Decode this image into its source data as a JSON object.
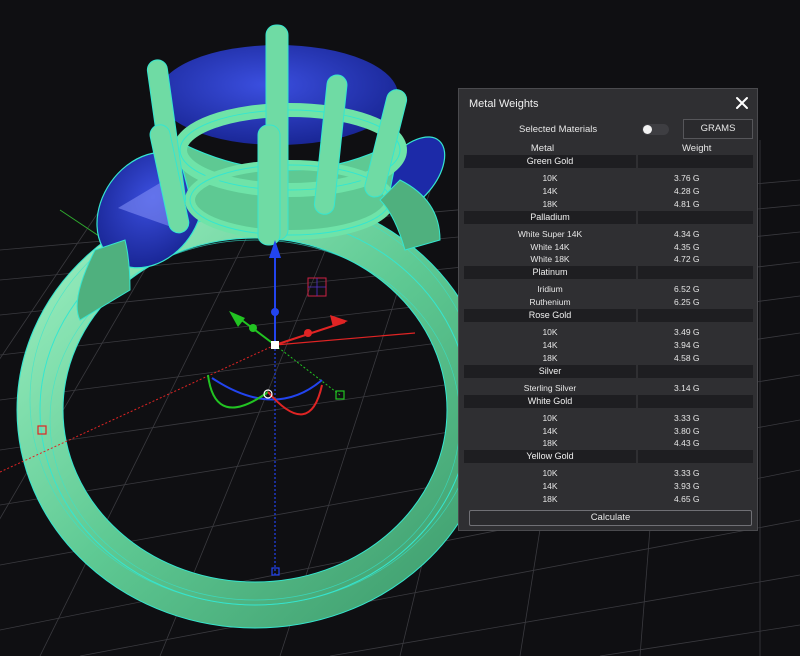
{
  "panel": {
    "title": "Metal Weights",
    "selected_materials_label": "Selected Materials",
    "units_button": "GRAMS",
    "calculate_button": "Calculate",
    "columns": {
      "metal": "Metal",
      "weight": "Weight"
    }
  },
  "groups": [
    {
      "name": "Green Gold",
      "rows": [
        {
          "metal": "10K",
          "weight": "3.76 G"
        },
        {
          "metal": "14K",
          "weight": "4.28 G"
        },
        {
          "metal": "18K",
          "weight": "4.81 G"
        }
      ]
    },
    {
      "name": "Palladium",
      "rows": [
        {
          "metal": "White Super 14K",
          "weight": "4.34 G"
        },
        {
          "metal": "White 14K",
          "weight": "4.35 G"
        },
        {
          "metal": "White 18K",
          "weight": "4.72 G"
        }
      ]
    },
    {
      "name": "Platinum",
      "rows": [
        {
          "metal": "Iridium",
          "weight": "6.52 G"
        },
        {
          "metal": "Ruthenium",
          "weight": "6.25 G"
        }
      ]
    },
    {
      "name": "Rose Gold",
      "rows": [
        {
          "metal": "10K",
          "weight": "3.49 G"
        },
        {
          "metal": "14K",
          "weight": "3.94 G"
        },
        {
          "metal": "18K",
          "weight": "4.58 G"
        }
      ]
    },
    {
      "name": "Silver",
      "rows": [
        {
          "metal": "Sterling Silver",
          "weight": "3.14 G"
        }
      ]
    },
    {
      "name": "White Gold",
      "rows": [
        {
          "metal": "10K",
          "weight": "3.33 G"
        },
        {
          "metal": "14K",
          "weight": "3.80 G"
        },
        {
          "metal": "18K",
          "weight": "4.43 G"
        }
      ]
    },
    {
      "name": "Yellow Gold",
      "rows": [
        {
          "metal": "10K",
          "weight": "3.33 G"
        },
        {
          "metal": "14K",
          "weight": "3.93 G"
        },
        {
          "metal": "18K",
          "weight": "4.65 G"
        }
      ]
    }
  ],
  "colors": {
    "metal_green": "#6fd7a3",
    "wire_cyan": "#35e6d0",
    "gem_blue": "#2233cc",
    "panel_bg": "#2f2f32",
    "axis_x": "#e02424",
    "axis_y": "#22c322",
    "axis_z": "#2244ee"
  },
  "icons": {
    "close": "close-icon"
  }
}
